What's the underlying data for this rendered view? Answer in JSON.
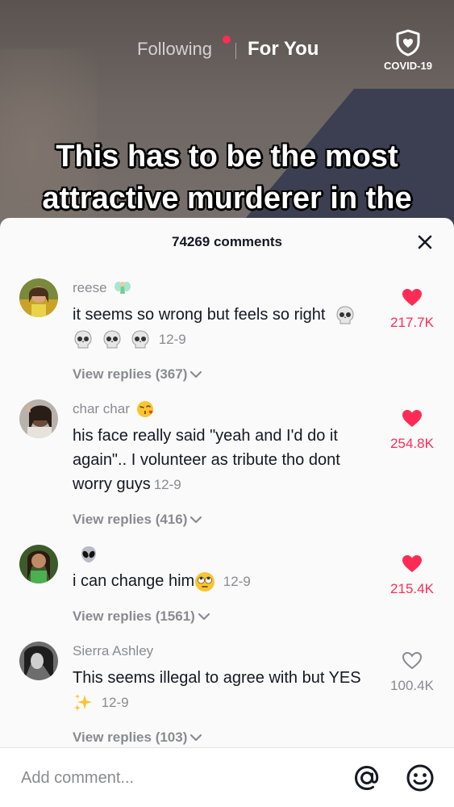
{
  "nav": {
    "tab_following": "Following",
    "tab_foryou": "For You",
    "covid_label": "COVID-19"
  },
  "video": {
    "caption_line1": "This has to be the most",
    "caption_line2": "attractive murderer in the"
  },
  "sheet": {
    "comment_count": "74269 comments",
    "close_icon": "close-icon"
  },
  "comments": [
    {
      "username": "reese",
      "text_1": "it seems so wrong but feels so right",
      "text_2": "",
      "date": "12-9",
      "likes": "217.7K",
      "liked": true,
      "view_replies": "View replies (367)"
    },
    {
      "username": "char char",
      "text_1": "his face really said \"yeah and I'd do it again\".. I volunteer as tribute tho dont worry guys",
      "date": "12-9",
      "likes": "254.8K",
      "liked": true,
      "view_replies": "View replies (416)"
    },
    {
      "username": "",
      "text_1": "i can change him",
      "date": "12-9",
      "likes": "215.4K",
      "liked": true,
      "view_replies": "View replies (1561)"
    },
    {
      "username": "Sierra Ashley",
      "text_1": "This seems illegal to agree with but YES",
      "date": "12-9",
      "likes": "100.4K",
      "liked": false,
      "view_replies": "View replies (103)"
    }
  ],
  "input": {
    "placeholder": "Add comment..."
  },
  "colors": {
    "accent": "#fe2c55",
    "muted": "#8a8b91",
    "text": "#161823"
  }
}
